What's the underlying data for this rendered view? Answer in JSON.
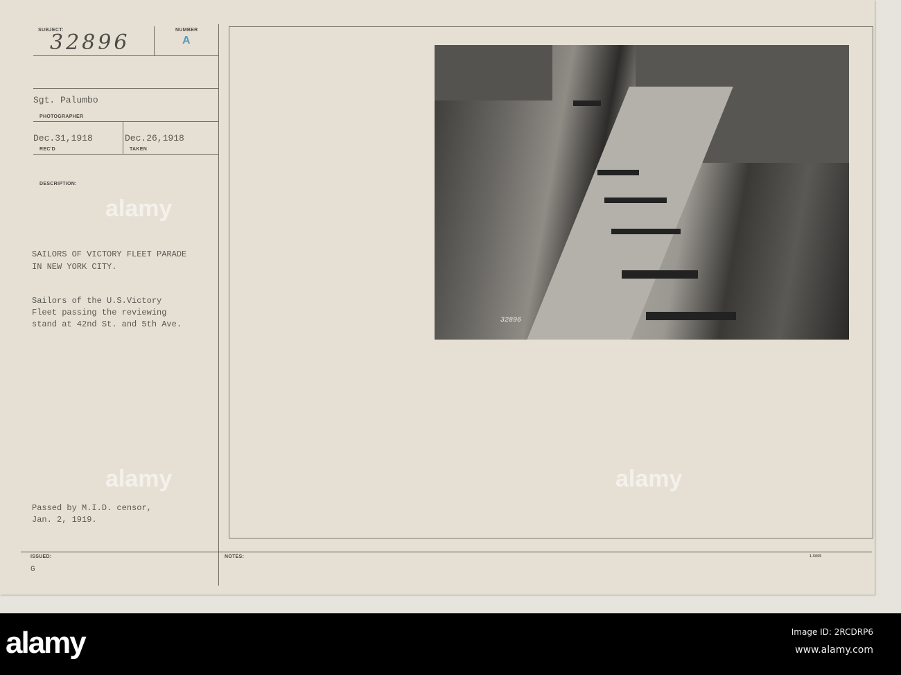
{
  "card": {
    "subject_label": "SUBJECT:",
    "subject_number": "32896",
    "number_label": "NUMBER",
    "number_value": "A",
    "photographer": "Sgt. Palumbo",
    "photographer_label": "PHOTOGRAPHER",
    "received_date": "Dec.31,1918",
    "received_label": "REC'D",
    "taken_date": "Dec.26,1918",
    "taken_label": "TAKEN",
    "description_label": "DESCRIPTION:",
    "title_line1": "SAILORS OF VICTORY FLEET PARADE",
    "title_line2": "IN NEW YORK CITY.",
    "desc_line1": "Sailors of the U.S.Victory",
    "desc_line2": "Fleet passing the reviewing",
    "desc_line3": "stand at 42nd St. and 5th Ave.",
    "censor_line1": "Passed by M.I.D. censor,",
    "censor_line2": "Jan. 2, 1919.",
    "issued_label": "ISSUED:",
    "issued_value": "G",
    "notes_label": "NOTES:",
    "form_code": "1-5005",
    "photo_number": "32896"
  },
  "watermark": {
    "text": "alamy",
    "glyph": "a"
  },
  "footer": {
    "logo": "alamy",
    "image_id": "Image ID: 2RCDRP6",
    "url": "www.alamy.com"
  },
  "colors": {
    "paper": "#e6e0d4",
    "stamp": "#5a9ab8",
    "footer": "#000000"
  }
}
